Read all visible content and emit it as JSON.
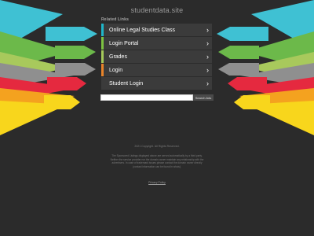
{
  "header": {
    "site_title": "studentdata.site"
  },
  "related": {
    "label": "Related Links",
    "items": [
      {
        "label": "Online Legal Studies Class",
        "accent": "#1fb6c9"
      },
      {
        "label": "Login Portal",
        "accent": "#7dc242"
      },
      {
        "label": "Grades",
        "accent": "#a5c95a"
      },
      {
        "label": "Login",
        "accent": "#e9842a"
      },
      {
        "label": "Student Login",
        "accent": "#3b3b3b"
      }
    ],
    "chevron": "›"
  },
  "search": {
    "placeholder": "",
    "button_label": "Search Ads"
  },
  "footer": {
    "copyright": "2021 Copyright. All Rights Reserved.",
    "disclaimer": "The Sponsored Listings displayed above are served automatically by a third party. Neither the service provider nor the domain owner maintain any relationship with the advertisers. In case of trademark issues please contact the domain owner directly (contact information can be found in whois).",
    "privacy_label": "Privacy Policy"
  },
  "colors": {
    "background": "#2b2b2b",
    "cyan": "#3fc1d3",
    "green": "#6cb94a",
    "lime": "#a8c95c",
    "gray": "#8f8f8f",
    "red": "#e5293f",
    "orange": "#f4a21f",
    "yellow": "#f8d61c"
  }
}
